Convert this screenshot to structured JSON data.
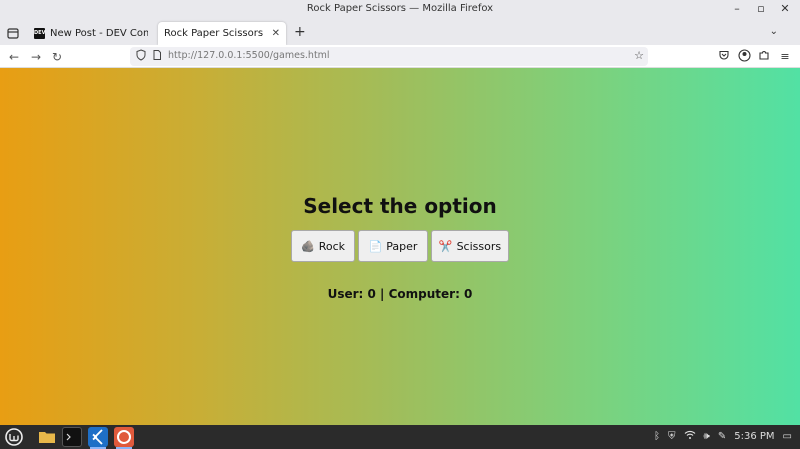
{
  "window": {
    "title": "Rock Paper Scissors — Mozilla Firefox"
  },
  "tabs": [
    {
      "label": "New Post - DEV Community",
      "favicon": "DEV"
    },
    {
      "label": "Rock Paper Scissors"
    }
  ],
  "navbar": {
    "url": "http://127.0.0.1:5500/games.html"
  },
  "page": {
    "heading": "Select the option",
    "buttons": [
      {
        "emoji": "🪨",
        "label": "Rock"
      },
      {
        "emoji": "📄",
        "label": "Paper"
      },
      {
        "emoji": "✂️",
        "label": "Scissors"
      }
    ],
    "score": "User: 0 | Computer: 0",
    "gradient_colors": [
      "#e89e13",
      "#52e1a4"
    ]
  },
  "taskbar": {
    "clock": "5:36 PM"
  }
}
